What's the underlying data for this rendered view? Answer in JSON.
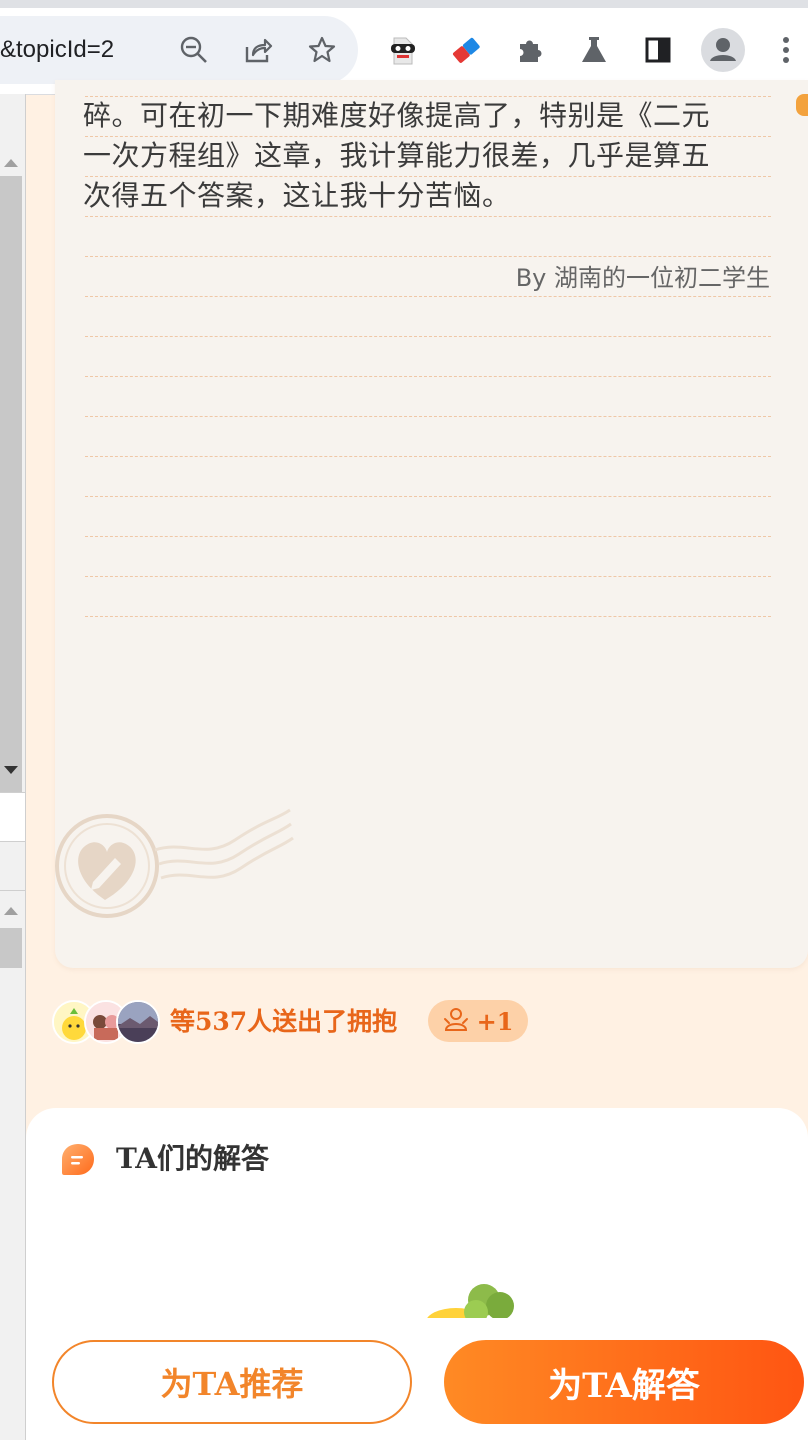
{
  "browser": {
    "url_fragment": "&topicId=2",
    "icons": [
      "zoom-out-icon",
      "share-icon",
      "bookmark-star-icon",
      "incognito-extension-icon",
      "eraser-extension-icon",
      "extensions-puzzle-icon",
      "labs-flask-icon",
      "side-panel-icon",
      "profile-avatar-icon",
      "more-menu-icon"
    ]
  },
  "letter": {
    "lines": [
      "碎。可在初一下期难度好像提高了，特别是《二元",
      "一次方程组》这章，我计算能力很差，几乎是算五",
      "次得五个答案，这让我十分苦恼。"
    ],
    "signature": "By 湖南的一位初二学生"
  },
  "hugs": {
    "text": "等537人送出了拥抱",
    "plus_label": "+1"
  },
  "answers": {
    "title": "TA们的解答"
  },
  "actions": {
    "recommend_label": "为TA推荐",
    "answer_label": "为TA解答"
  },
  "colors": {
    "accent": "#f2852a",
    "accent_gradient_end": "#ff5512",
    "page_bg": "#fff1e3",
    "paper_bg": "#f7f3ee"
  }
}
